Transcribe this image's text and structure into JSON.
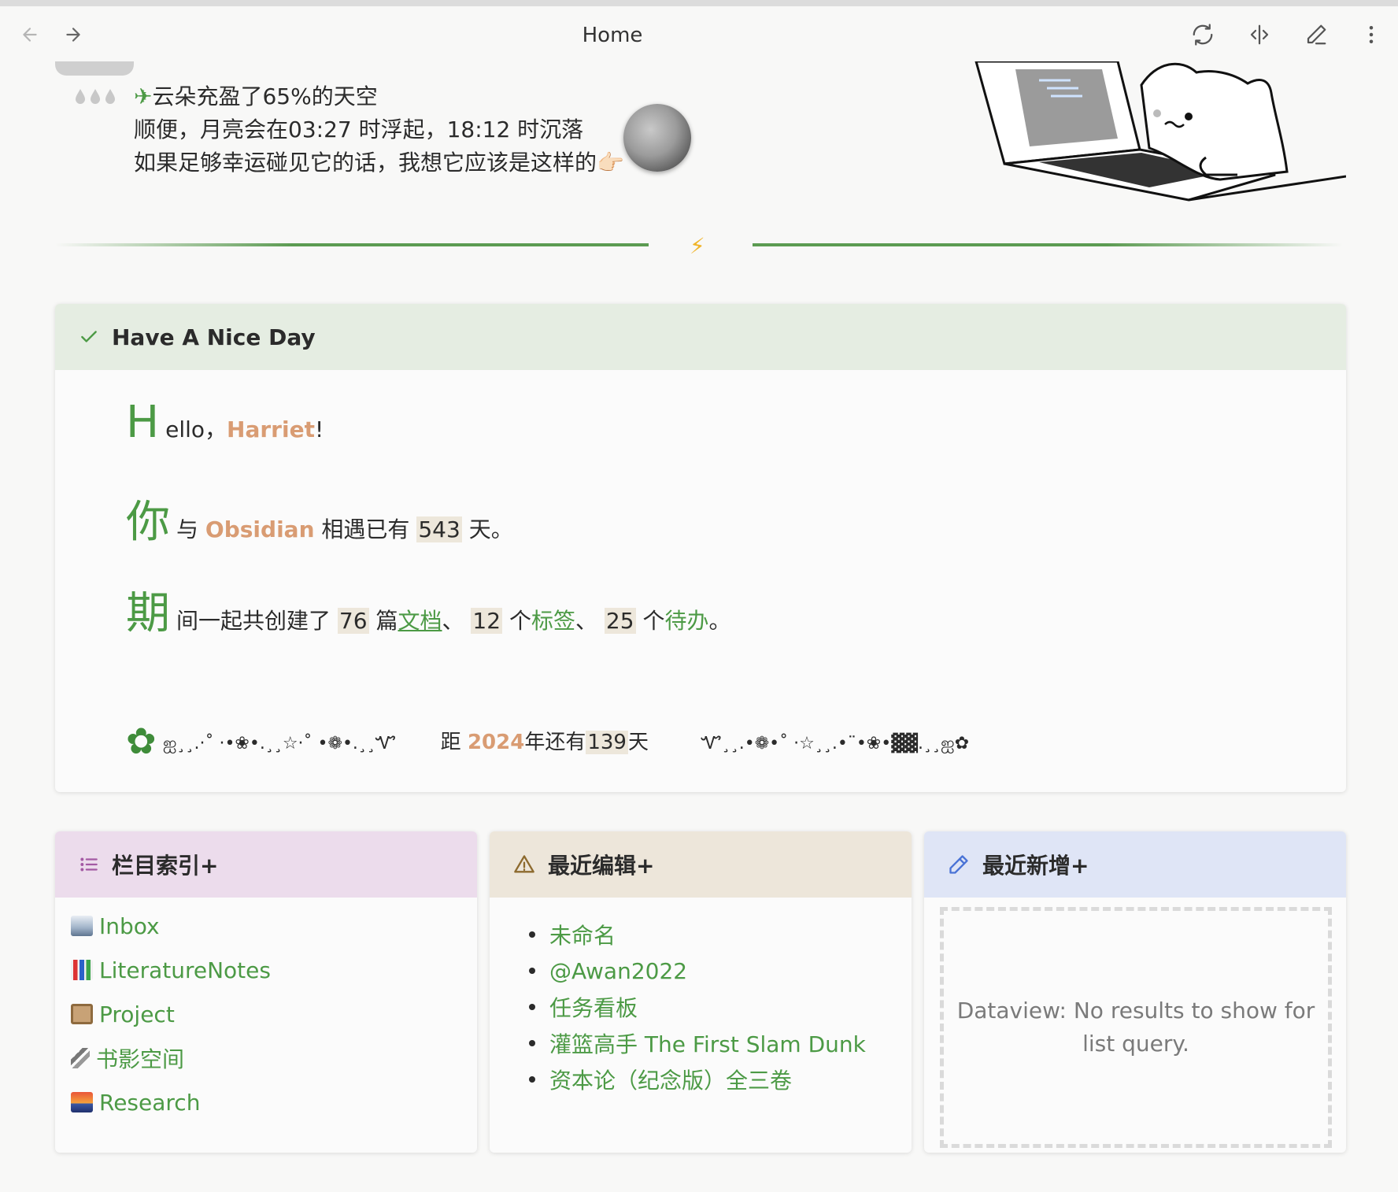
{
  "toolbar": {
    "title": "Home",
    "icons": [
      "arrow-left-icon",
      "arrow-right-icon",
      "refresh-icon",
      "split-view-icon",
      "edit-pencil-icon",
      "more-vertical-icon"
    ]
  },
  "weather": {
    "line1": "云朵充盈了65%的天空",
    "line2": "顺便，月亮会在03:27 时浮起，18:12 时沉落",
    "line3": "如果足够幸运碰见它的话，我想它应该是这样的👉🏻",
    "plane": "✈"
  },
  "divider": {
    "bolt": "⚡"
  },
  "greeting_card": {
    "title": "Have A Nice Day",
    "hello_big": "H",
    "hello_text": "ello，",
    "name": "Harriet",
    "hello_end": "!",
    "you_big": "你",
    "you_text1": "与",
    "app": "Obsidian",
    "you_text2": "相遇已有",
    "days": "543",
    "you_text3": "天。",
    "period_big": "期",
    "period_text1": "间一起共创建了",
    "docs_count": "76",
    "period_unit1": "篇",
    "docs_label": "文档",
    "sep1": "、",
    "tags_count": "12",
    "period_unit2": "个",
    "tags_label": "标签",
    "sep2": "、",
    "todo_count": "25",
    "period_unit3": "个",
    "todo_label": "待办",
    "period_end": "。",
    "clover": "✿",
    "deco_left": "ஐ¸¸.·˚ ·•❀•.¸¸☆·˚ •❁•.¸¸Ꮙ",
    "countdown_prefix": "距",
    "year": "2024",
    "countdown_mid": "年还有",
    "countdown_days": "139",
    "countdown_suffix": "天",
    "deco_right": "Ꮙ¸¸.•❁•˚ ·☆¸¸.•¨•❀•▓▓.¸¸ஐ✿"
  },
  "index_card": {
    "title": "栏目索引+",
    "items": [
      {
        "label": "Inbox",
        "icon": "inbox-tray-icon"
      },
      {
        "label": "LiteratureNotes",
        "icon": "bar-chart-icon"
      },
      {
        "label": "Project",
        "icon": "clipboard-icon"
      },
      {
        "label": "书影空间",
        "icon": "paperclip-icon"
      },
      {
        "label": "Research",
        "icon": "sunset-picture-icon"
      }
    ]
  },
  "recent_edit_card": {
    "title": "最近编辑+",
    "items": [
      "未命名",
      "@Awan2022",
      "任务看板",
      "灌篮高手 The First Slam Dunk",
      "资本论（纪念版）全三卷"
    ]
  },
  "recent_new_card": {
    "title": "最近新增+",
    "empty_message": "Dataview: No results to show for list query."
  },
  "colors": {
    "accent_green": "#4c9a45",
    "name_orange": "#d99c73",
    "header_green": "#e5ede2",
    "header_pink": "#ecdcec",
    "header_beige": "#ede6da",
    "header_blue": "#dfe5f6"
  }
}
